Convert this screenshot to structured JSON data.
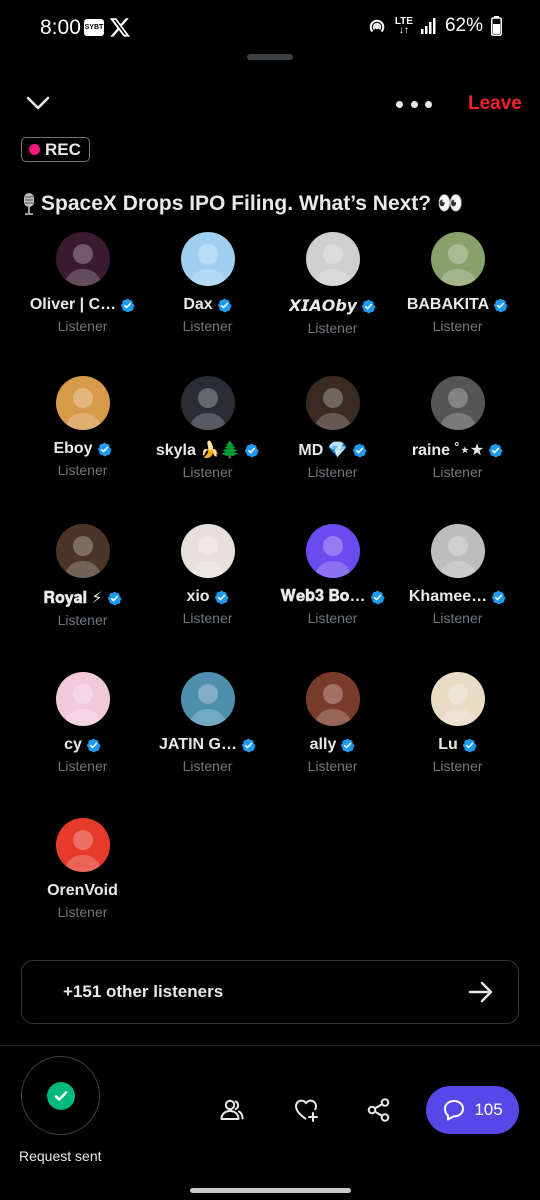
{
  "status_bar": {
    "time": "8:00",
    "app_badge": "SYBT",
    "lte_top": "LTE",
    "lte_bottom": "↓↑",
    "battery": "62%"
  },
  "header": {
    "leave_label": "Leave",
    "rec_label": "REC",
    "title": "SpaceX Drops IPO Filing. What’s Next? 👀"
  },
  "participants": [
    {
      "name": "Oliver | C…",
      "role": "Listener",
      "verified": true,
      "avatar_color": "#3a1a2e"
    },
    {
      "name": "Dax",
      "role": "Listener",
      "verified": true,
      "avatar_color": "#9fd0f0"
    },
    {
      "name": "𝙓𝙄𝘼𝙊𝙗𝙮",
      "role": "Listener",
      "verified": true,
      "avatar_color": "#cfcfcf"
    },
    {
      "name": "BABAKITA",
      "role": "Listener",
      "verified": true,
      "avatar_color": "#8aa06a"
    },
    {
      "name": "Eboy",
      "role": "Listener",
      "verified": true,
      "avatar_color": "#d79a4a"
    },
    {
      "name": "skyla 🍌🌲",
      "role": "Listener",
      "verified": true,
      "avatar_color": "#2a2d33"
    },
    {
      "name": "MD 💎",
      "role": "Listener",
      "verified": true,
      "avatar_color": "#3b2a22"
    },
    {
      "name": "raine ˚⋆★",
      "role": "Listener",
      "verified": true,
      "avatar_color": "#555555"
    },
    {
      "name": "𝐑𝐨𝐲𝐚𝐥 ⚡",
      "role": "Listener",
      "verified": true,
      "avatar_color": "#4a3527"
    },
    {
      "name": "xio",
      "role": "Listener",
      "verified": true,
      "avatar_color": "#e6e0dc"
    },
    {
      "name": "𝐖𝐞𝐛𝟑 𝐁𝐨…",
      "role": "Listener",
      "verified": true,
      "avatar_color": "#6a4cf0"
    },
    {
      "name": "Khamee…",
      "role": "Listener",
      "verified": true,
      "avatar_color": "#bdbdbd"
    },
    {
      "name": "cy",
      "role": "Listener",
      "verified": true,
      "avatar_color": "#f2c9d9"
    },
    {
      "name": "JATIN G…",
      "role": "Listener",
      "verified": true,
      "avatar_color": "#4e8fb0"
    },
    {
      "name": "ally",
      "role": "Listener",
      "verified": true,
      "avatar_color": "#7a3c2a"
    },
    {
      "name": "Lu",
      "role": "Listener",
      "verified": true,
      "avatar_color": "#e9dcc4"
    },
    {
      "name": "OrenVoid",
      "role": "Listener",
      "verified": false,
      "avatar_color": "#e63a2a"
    }
  ],
  "listeners_summary": "+151 other listeners",
  "bottom": {
    "request_label": "Request sent",
    "chat_count": "105"
  },
  "colors": {
    "accent_red": "#f4212e",
    "rec_dot": "#f91880",
    "verified_blue": "#1d9bf0",
    "chat_purple": "#5847e8",
    "success_green": "#00ba7c"
  }
}
